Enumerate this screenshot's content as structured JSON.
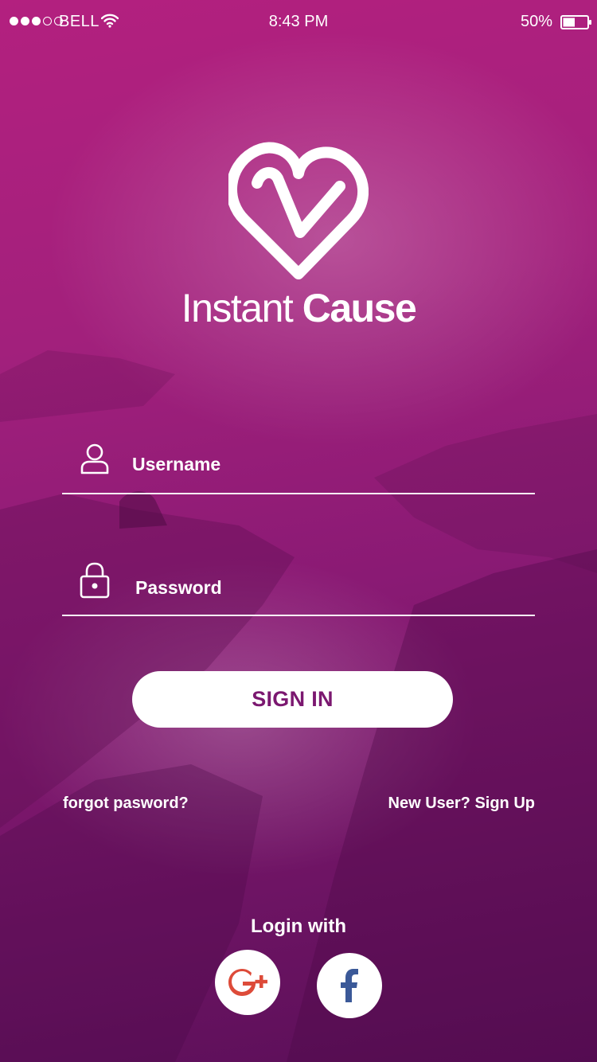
{
  "status_bar": {
    "carrier": "BELL",
    "time": "8:43 PM",
    "battery": "50%",
    "battery_level": 0.5,
    "signal_bars": 3,
    "signal_total": 5
  },
  "app": {
    "title_light": "Instant",
    "title_bold": "Cause",
    "logo_icon": "heart-check-icon"
  },
  "form": {
    "username_placeholder": "Username",
    "username_icon": "user-icon",
    "password_placeholder": "Password",
    "password_icon": "lock-icon",
    "sign_in_label": "SIGN IN"
  },
  "links": {
    "forgot": "forgot pasword?",
    "signup": "New User? Sign Up"
  },
  "social": {
    "heading": "Login with",
    "google_icon": "google-plus-icon",
    "facebook_icon": "facebook-icon"
  },
  "colors": {
    "background_top": "#b3207f",
    "background_bottom": "#5a0f58",
    "sign_in_text": "#7b1870",
    "google": "#dd4b39",
    "facebook": "#3b5998"
  }
}
